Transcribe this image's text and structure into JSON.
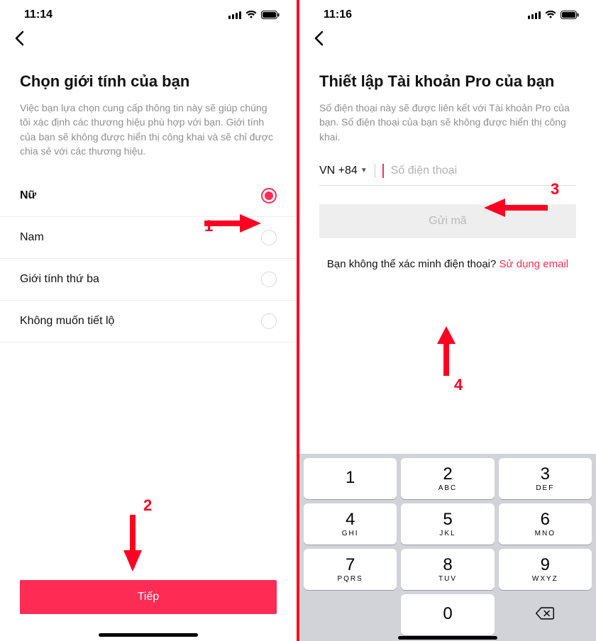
{
  "left": {
    "time": "11:14",
    "title": "Chọn giới tính của bạn",
    "desc": "Việc bạn lựa chọn cung cấp thông tin này sẽ giúp chúng tôi xác định các thương hiệu phù hợp với bạn. Giới tính của bạn sẽ không được hiển thị công khai và sẽ chỉ được chia sẻ với các thương hiệu.",
    "options": [
      "Nữ",
      "Nam",
      "Giới tính thứ ba",
      "Không muốn tiết lộ"
    ],
    "cta": "Tiếp",
    "ann1": "1",
    "ann2": "2"
  },
  "right": {
    "time": "11:16",
    "title": "Thiết lập Tài khoản Pro của bạn",
    "desc": "Số điện thoại này sẽ được liên kết với Tài khoản Pro của bạn. Số điện thoại của bạn sẽ không được hiển thị công khai.",
    "country": "VN +84",
    "phone_placeholder": "Số điện thoại",
    "send": "Gửi mã",
    "alt_q": "Bạn không thể xác minh điện thoại? ",
    "alt_link": "Sử dụng email",
    "ann3": "3",
    "ann4": "4",
    "keypad": [
      [
        {
          "n": "1",
          "l": ""
        },
        {
          "n": "2",
          "l": "ABC"
        },
        {
          "n": "3",
          "l": "DEF"
        }
      ],
      [
        {
          "n": "4",
          "l": "GHI"
        },
        {
          "n": "5",
          "l": "JKL"
        },
        {
          "n": "6",
          "l": "MNO"
        }
      ],
      [
        {
          "n": "7",
          "l": "PQRS"
        },
        {
          "n": "8",
          "l": "TUV"
        },
        {
          "n": "9",
          "l": "WXYZ"
        }
      ]
    ],
    "zero": {
      "n": "0",
      "l": ""
    }
  }
}
